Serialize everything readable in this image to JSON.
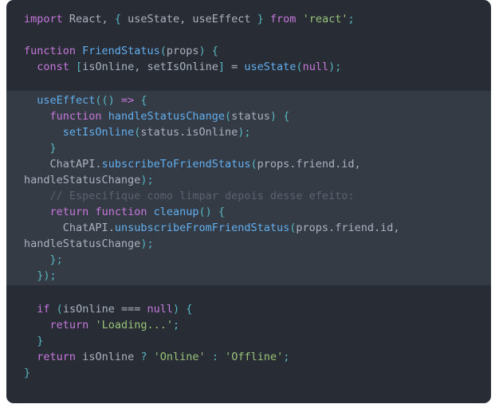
{
  "card": {
    "background": "#282c34",
    "highlight_background": "#353b45",
    "corner_radius": "9px"
  },
  "palette": {
    "keyword": "#c678dd",
    "function": "#61afef",
    "string": "#98c379",
    "punctuation": "#56b6c2",
    "identifier": "#abb2bf",
    "comment": "#5c6370",
    "operator": "#abb2bf"
  },
  "code": {
    "language": "jsx",
    "lines": [
      {
        "id": "line-1",
        "highlight": false,
        "tokens": [
          {
            "t": "import",
            "c": "kw"
          },
          {
            "t": " React, ",
            "c": "id"
          },
          {
            "t": "{",
            "c": "pun"
          },
          {
            "t": " useState, useEffect ",
            "c": "id"
          },
          {
            "t": "}",
            "c": "pun"
          },
          {
            "t": " ",
            "c": "id"
          },
          {
            "t": "from",
            "c": "kw"
          },
          {
            "t": " ",
            "c": "id"
          },
          {
            "t": "'react'",
            "c": "str"
          },
          {
            "t": ";",
            "c": "pun"
          }
        ]
      },
      {
        "id": "line-2",
        "highlight": false,
        "tokens": []
      },
      {
        "id": "line-3",
        "highlight": false,
        "tokens": [
          {
            "t": "function",
            "c": "kw"
          },
          {
            "t": " ",
            "c": "id"
          },
          {
            "t": "FriendStatus",
            "c": "fn"
          },
          {
            "t": "(",
            "c": "pun"
          },
          {
            "t": "props",
            "c": "id"
          },
          {
            "t": ")",
            "c": "pun"
          },
          {
            "t": " ",
            "c": "id"
          },
          {
            "t": "{",
            "c": "pun"
          }
        ]
      },
      {
        "id": "line-4",
        "highlight": false,
        "tokens": [
          {
            "t": "  ",
            "c": "id"
          },
          {
            "t": "const",
            "c": "kw"
          },
          {
            "t": " ",
            "c": "id"
          },
          {
            "t": "[",
            "c": "pun"
          },
          {
            "t": "isOnline, setIsOnline",
            "c": "id"
          },
          {
            "t": "]",
            "c": "pun"
          },
          {
            "t": " = ",
            "c": "op"
          },
          {
            "t": "useState",
            "c": "fn"
          },
          {
            "t": "(",
            "c": "pun"
          },
          {
            "t": "null",
            "c": "kw"
          },
          {
            "t": ");",
            "c": "pun"
          }
        ]
      },
      {
        "id": "line-5",
        "highlight": false,
        "tokens": []
      },
      {
        "id": "line-6",
        "highlight": true,
        "tokens": [
          {
            "t": "  ",
            "c": "id"
          },
          {
            "t": "useEffect",
            "c": "fn"
          },
          {
            "t": "(()",
            "c": "pun"
          },
          {
            "t": " ",
            "c": "id"
          },
          {
            "t": "=>",
            "c": "kw"
          },
          {
            "t": " ",
            "c": "id"
          },
          {
            "t": "{",
            "c": "pun"
          }
        ]
      },
      {
        "id": "line-7",
        "highlight": true,
        "tokens": [
          {
            "t": "    ",
            "c": "id"
          },
          {
            "t": "function",
            "c": "kw"
          },
          {
            "t": " ",
            "c": "id"
          },
          {
            "t": "handleStatusChange",
            "c": "fn"
          },
          {
            "t": "(",
            "c": "pun"
          },
          {
            "t": "status",
            "c": "id"
          },
          {
            "t": ")",
            "c": "pun"
          },
          {
            "t": " ",
            "c": "id"
          },
          {
            "t": "{",
            "c": "pun"
          }
        ]
      },
      {
        "id": "line-8",
        "highlight": true,
        "tokens": [
          {
            "t": "      ",
            "c": "id"
          },
          {
            "t": "setIsOnline",
            "c": "fn"
          },
          {
            "t": "(",
            "c": "pun"
          },
          {
            "t": "status.isOnline",
            "c": "id"
          },
          {
            "t": ");",
            "c": "pun"
          }
        ]
      },
      {
        "id": "line-9",
        "highlight": true,
        "tokens": [
          {
            "t": "    ",
            "c": "id"
          },
          {
            "t": "}",
            "c": "pun"
          }
        ]
      },
      {
        "id": "line-10",
        "highlight": true,
        "tokens": [
          {
            "t": "    ",
            "c": "id"
          },
          {
            "t": "ChatAPI",
            "c": "id"
          },
          {
            "t": ".",
            "c": "op"
          },
          {
            "t": "subscribeToFriendStatus",
            "c": "fn"
          },
          {
            "t": "(",
            "c": "pun"
          },
          {
            "t": "props.friend.id, handleStatusChange",
            "c": "id"
          },
          {
            "t": ");",
            "c": "pun"
          }
        ]
      },
      {
        "id": "line-11",
        "highlight": true,
        "tokens": [
          {
            "t": "    ",
            "c": "id"
          },
          {
            "t": "// Especifique como limpar depois desse efeito:",
            "c": "com"
          }
        ]
      },
      {
        "id": "line-12",
        "highlight": true,
        "tokens": [
          {
            "t": "    ",
            "c": "id"
          },
          {
            "t": "return",
            "c": "kw"
          },
          {
            "t": " ",
            "c": "id"
          },
          {
            "t": "function",
            "c": "kw"
          },
          {
            "t": " ",
            "c": "id"
          },
          {
            "t": "cleanup",
            "c": "fn"
          },
          {
            "t": "()",
            "c": "pun"
          },
          {
            "t": " ",
            "c": "id"
          },
          {
            "t": "{",
            "c": "pun"
          }
        ]
      },
      {
        "id": "line-13",
        "highlight": true,
        "tokens": [
          {
            "t": "      ",
            "c": "id"
          },
          {
            "t": "ChatAPI",
            "c": "id"
          },
          {
            "t": ".",
            "c": "op"
          },
          {
            "t": "unsubscribeFromFriendStatus",
            "c": "fn"
          },
          {
            "t": "(",
            "c": "pun"
          },
          {
            "t": "props.friend.id, handleStatusChange",
            "c": "id"
          },
          {
            "t": ");",
            "c": "pun"
          }
        ]
      },
      {
        "id": "line-14",
        "highlight": true,
        "tokens": [
          {
            "t": "    ",
            "c": "id"
          },
          {
            "t": "};",
            "c": "pun"
          }
        ]
      },
      {
        "id": "line-15",
        "highlight": true,
        "tokens": [
          {
            "t": "  ",
            "c": "id"
          },
          {
            "t": "});",
            "c": "pun"
          }
        ]
      },
      {
        "id": "line-16",
        "highlight": false,
        "tokens": []
      },
      {
        "id": "line-17",
        "highlight": false,
        "tokens": [
          {
            "t": "  ",
            "c": "id"
          },
          {
            "t": "if",
            "c": "kw"
          },
          {
            "t": " ",
            "c": "id"
          },
          {
            "t": "(",
            "c": "pun"
          },
          {
            "t": "isOnline",
            "c": "id"
          },
          {
            "t": " === ",
            "c": "op"
          },
          {
            "t": "null",
            "c": "kw"
          },
          {
            "t": ")",
            "c": "pun"
          },
          {
            "t": " ",
            "c": "id"
          },
          {
            "t": "{",
            "c": "pun"
          }
        ]
      },
      {
        "id": "line-18",
        "highlight": false,
        "tokens": [
          {
            "t": "    ",
            "c": "id"
          },
          {
            "t": "return",
            "c": "kw"
          },
          {
            "t": " ",
            "c": "id"
          },
          {
            "t": "'Loading...'",
            "c": "str"
          },
          {
            "t": ";",
            "c": "pun"
          }
        ]
      },
      {
        "id": "line-19",
        "highlight": false,
        "tokens": [
          {
            "t": "  ",
            "c": "id"
          },
          {
            "t": "}",
            "c": "pun"
          }
        ]
      },
      {
        "id": "line-20",
        "highlight": false,
        "tokens": [
          {
            "t": "  ",
            "c": "id"
          },
          {
            "t": "return",
            "c": "kw"
          },
          {
            "t": " ",
            "c": "id"
          },
          {
            "t": "isOnline",
            "c": "id"
          },
          {
            "t": " ",
            "c": "id"
          },
          {
            "t": "?",
            "c": "pun"
          },
          {
            "t": " ",
            "c": "id"
          },
          {
            "t": "'Online'",
            "c": "str"
          },
          {
            "t": " ",
            "c": "id"
          },
          {
            "t": ":",
            "c": "pun"
          },
          {
            "t": " ",
            "c": "id"
          },
          {
            "t": "'Offline'",
            "c": "str"
          },
          {
            "t": ";",
            "c": "pun"
          }
        ]
      },
      {
        "id": "line-21",
        "highlight": false,
        "tokens": [
          {
            "t": "}",
            "c": "pun"
          }
        ]
      }
    ]
  }
}
